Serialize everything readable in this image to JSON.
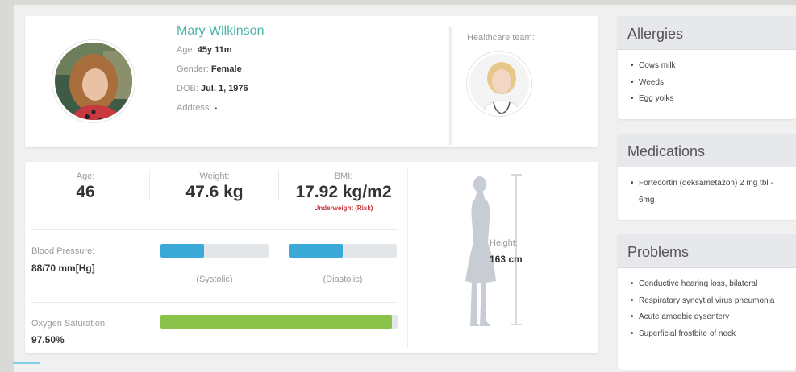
{
  "patient": {
    "name": "Mary Wilkinson",
    "age_label": "Age: ",
    "age_value": "45y 11m",
    "gender_label": "Gender: ",
    "gender_value": "Female",
    "dob_label": "DOB: ",
    "dob_value": "Jul. 1, 1976",
    "address_label": "Address: ",
    "address_value": "-"
  },
  "team": {
    "title": "Healthcare team:"
  },
  "vitals": {
    "age_label": "Age:",
    "age_value": "46",
    "weight_label": "Weight:",
    "weight_value": "47.6 kg",
    "bmi_label": "BMI:",
    "bmi_value": "17.92 kg/m2",
    "bmi_status": "Underweight (Risk)",
    "bp_label": "Blood Pressure:",
    "bp_value": "88/70 mm[Hg]",
    "systolic_caption": "(Systolic)",
    "diastolic_caption": "(Diastolic)",
    "systolic_fraction": 0.4,
    "diastolic_fraction": 0.5,
    "oxygen_label": "Oxygen Saturation:",
    "oxygen_value": "97.50%",
    "oxygen_fraction": 0.975,
    "height_label": "Height:",
    "height_value": "163 cm"
  },
  "colors": {
    "accent_teal": "#4bb3a4",
    "bar_blue": "#3aa9d7",
    "bar_green": "#8bc34a",
    "risk_red": "#c8333a"
  },
  "allergies": {
    "title": "Allergies",
    "items": [
      "Cows milk",
      "Weeds",
      "Egg yolks"
    ]
  },
  "medications": {
    "title": "Medications",
    "items": [
      "Fortecortin (deksametazon) 2 mg tbl - 6mg"
    ]
  },
  "problems": {
    "title": "Problems",
    "items": [
      "Conductive hearing loss, bilateral",
      "Respiratory syncytial virus pneumonia",
      "Acute amoebic dysentery",
      "Superficial frostbite of neck"
    ]
  }
}
